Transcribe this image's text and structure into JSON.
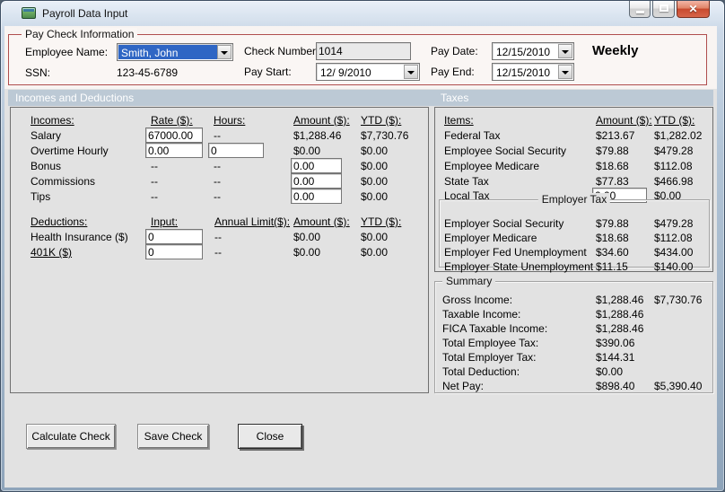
{
  "window": {
    "title": "Payroll Data Input",
    "icons": {
      "close_glyph": "✕"
    }
  },
  "colors": {
    "section_bar": "#bcc9d5",
    "paycheck_group_border": "#b04e4e",
    "combo_selection": "#2f66c4",
    "close_button_red": "#c84a2e",
    "client_background": "#e2e2e2"
  },
  "paycheck": {
    "group_title": "Pay Check Information",
    "employee_name": {
      "label": "Employee Name:",
      "value": "Smith, John"
    },
    "ssn": {
      "label": "SSN:",
      "value": "123-45-6789"
    },
    "check_number": {
      "label": "Check Number:",
      "value": "1014"
    },
    "pay_start": {
      "label": "Pay Start:",
      "value": "12/ 9/2010"
    },
    "pay_date": {
      "label": "Pay Date:",
      "value": "12/15/2010"
    },
    "pay_end": {
      "label": "Pay End:",
      "value": "12/15/2010"
    },
    "frequency": "Weekly"
  },
  "section_headers": {
    "left": "Incomes and Deductions",
    "right": "Taxes"
  },
  "incomes": {
    "headers": {
      "item": "Incomes:",
      "rate": "Rate ($):",
      "hours": "Hours:",
      "amount": "Amount ($):",
      "ytd": "YTD ($):"
    },
    "rows": [
      {
        "label": "Salary",
        "rate": "67000.00",
        "hours": "--",
        "amount": "$1,288.46",
        "ytd": "$7,730.76"
      },
      {
        "label": "Overtime Hourly",
        "rate": "0.00",
        "hours": "0",
        "amount": "$0.00",
        "ytd": "$0.00"
      },
      {
        "label": "Bonus",
        "rate": "--",
        "hours": "--",
        "amount": "0.00",
        "ytd": "$0.00"
      },
      {
        "label": "Commissions",
        "rate": "--",
        "hours": "--",
        "amount": "0.00",
        "ytd": "$0.00"
      },
      {
        "label": "Tips",
        "rate": "--",
        "hours": "--",
        "amount": "0.00",
        "ytd": "$0.00"
      }
    ]
  },
  "deductions": {
    "headers": {
      "item": "Deductions:",
      "input": "Input:",
      "annual_limit": "Annual Limit($):",
      "amount": "Amount ($):",
      "ytd": "YTD ($):"
    },
    "rows": [
      {
        "label": "Health Insurance  ($)",
        "input": "0",
        "annual_limit": "--",
        "amount": "$0.00",
        "ytd": "$0.00"
      },
      {
        "label": "401K  ($)",
        "input": "0",
        "annual_limit": "--",
        "amount": "$0.00",
        "ytd": "$0.00"
      }
    ]
  },
  "taxes": {
    "headers": {
      "item": "Items:",
      "amount": "Amount ($):",
      "ytd": "YTD ($):"
    },
    "employee_rows": [
      {
        "label": "Federal Tax",
        "amount": "$213.67",
        "ytd": "$1,282.02"
      },
      {
        "label": "Employee Social Security",
        "amount": "$79.88",
        "ytd": "$479.28"
      },
      {
        "label": "Employee Medicare",
        "amount": "$18.68",
        "ytd": "$112.08"
      },
      {
        "label": "State Tax",
        "amount": "$77.83",
        "ytd": "$466.98"
      },
      {
        "label": "Local Tax",
        "amount": "0.00",
        "ytd": "$0.00"
      }
    ],
    "employer_group_title": "Employer Tax",
    "employer_rows": [
      {
        "label": "Employer Social Security",
        "amount": "$79.88",
        "ytd": "$479.28"
      },
      {
        "label": "Employer Medicare",
        "amount": "$18.68",
        "ytd": "$112.08"
      },
      {
        "label": "Employer Fed Unemployment",
        "amount": "$34.60",
        "ytd": "$434.00"
      },
      {
        "label": "Employer State Unemployment",
        "amount": "$11.15",
        "ytd": "$140.00"
      }
    ]
  },
  "summary": {
    "group_title": "Summary",
    "rows": [
      {
        "label": "Gross Income:",
        "amount": "$1,288.46",
        "ytd": "$7,730.76"
      },
      {
        "label": "Taxable Income:",
        "amount": "$1,288.46",
        "ytd": ""
      },
      {
        "label": "FICA Taxable Income:",
        "amount": "$1,288.46",
        "ytd": ""
      },
      {
        "label": "Total Employee Tax:",
        "amount": "$390.06",
        "ytd": ""
      },
      {
        "label": "Total Employer Tax:",
        "amount": "$144.31",
        "ytd": ""
      },
      {
        "label": "Total Deduction:",
        "amount": "$0.00",
        "ytd": ""
      },
      {
        "label": "Net Pay:",
        "amount": "$898.40",
        "ytd": "$5,390.40"
      }
    ]
  },
  "actions": {
    "calculate": "Calculate Check",
    "save": "Save Check",
    "close": "Close"
  }
}
